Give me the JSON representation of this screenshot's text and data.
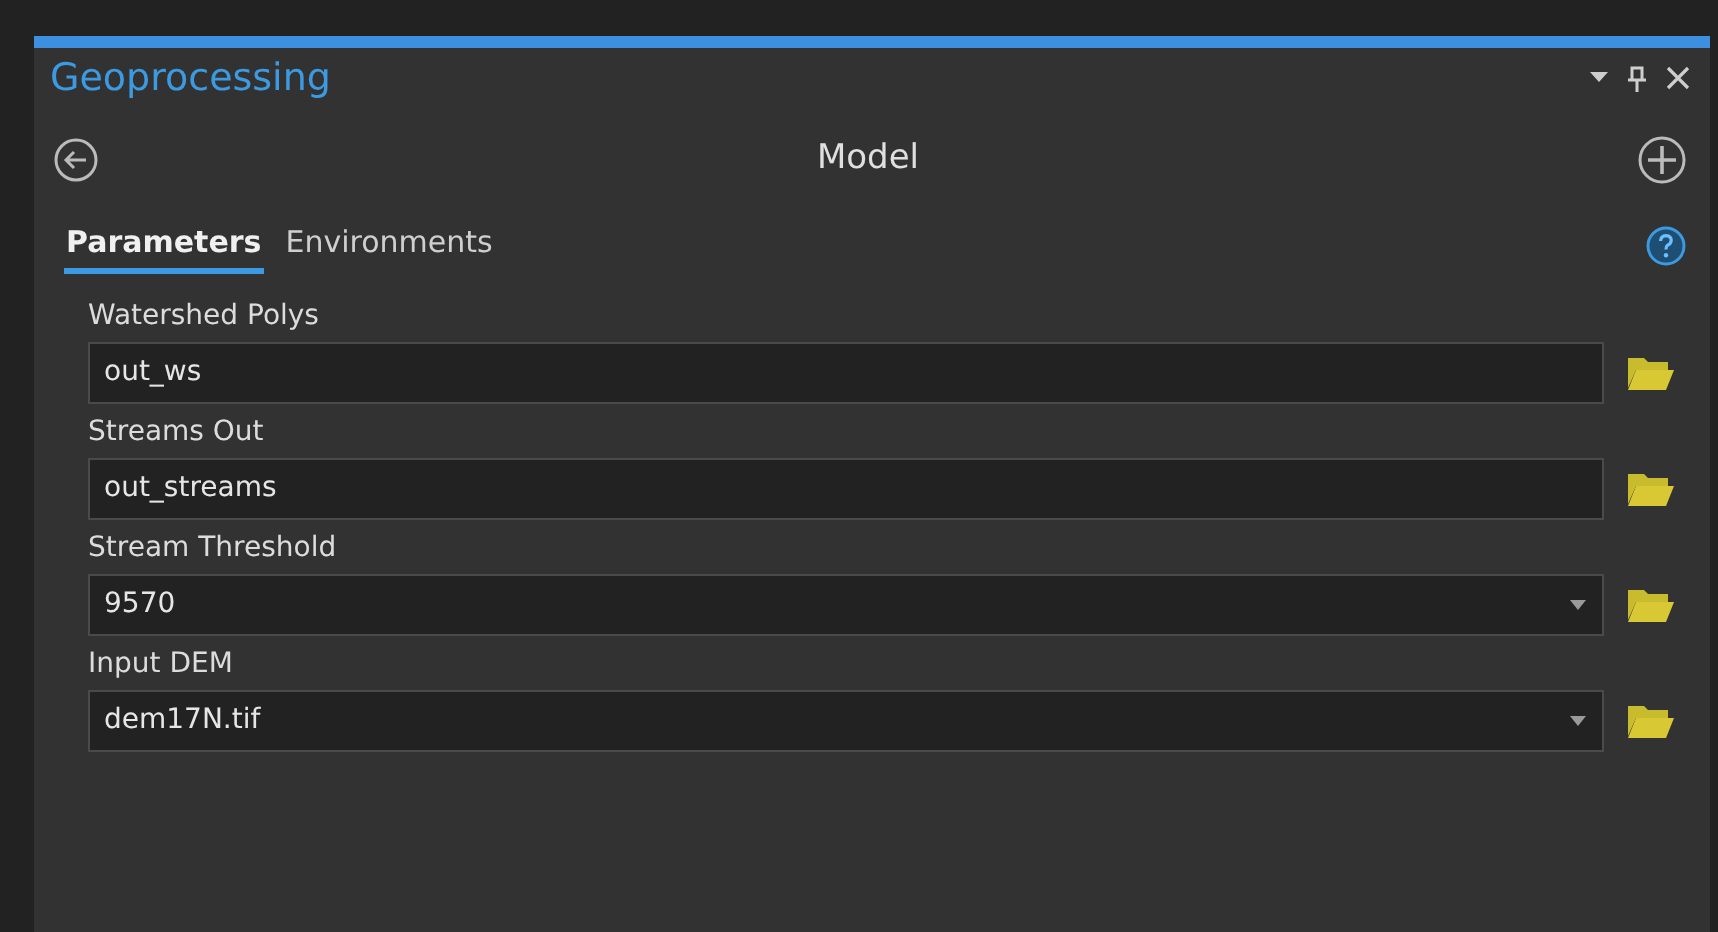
{
  "pane": {
    "title": "Geoprocessing",
    "tool_title": "Model"
  },
  "tabs": [
    {
      "label": "Parameters",
      "selected": true
    },
    {
      "label": "Environments",
      "selected": false
    }
  ],
  "parameters": [
    {
      "label": "Watershed Polys",
      "value": "out_ws",
      "kind": "text"
    },
    {
      "label": "Streams Out",
      "value": "out_streams",
      "kind": "text"
    },
    {
      "label": "Stream Threshold",
      "value": "9570",
      "kind": "dropdown"
    },
    {
      "label": "Input DEM",
      "value": "dem17N.tif",
      "kind": "dropdown"
    }
  ]
}
